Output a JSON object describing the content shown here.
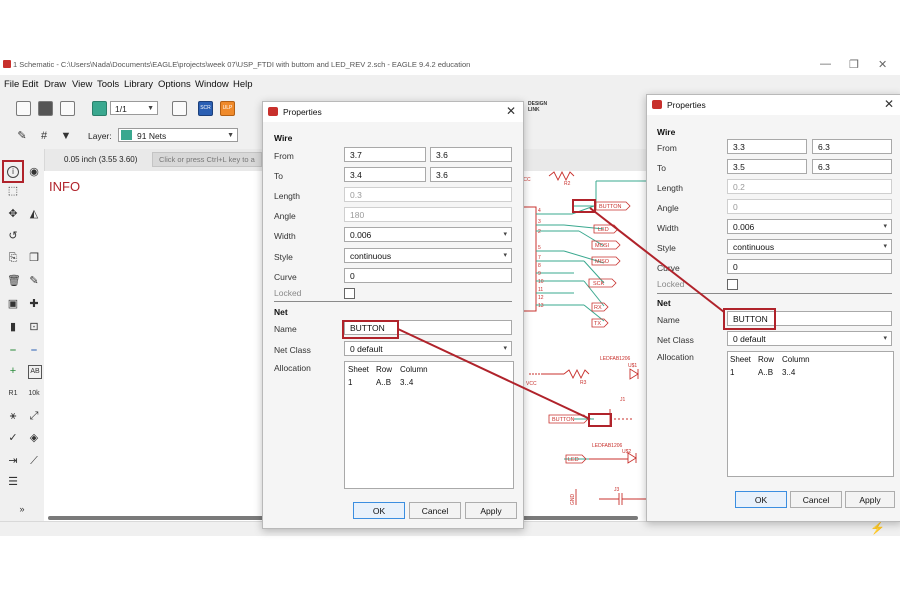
{
  "window": {
    "title": "1 Schematic - C:\\Users\\Nada\\Documents\\EAGLE\\projects\\week 07\\USP_FTDI with buttom and LED_REV 2.sch - EAGLE 9.4.2 education",
    "minimize": "—",
    "maximize": "❐",
    "close": "✕"
  },
  "menu": [
    "File",
    "Edit",
    "Draw",
    "View",
    "Tools",
    "Library",
    "Options",
    "Window",
    "Help"
  ],
  "toolbar": {
    "sheet_select": "1/1",
    "scr_label": "SCR",
    "ulp_label": "ULP",
    "design_link": "DESIGN LINK"
  },
  "layer_bar": {
    "layer_label": "Layer:",
    "layer_value": "91 Nets",
    "layer_color": "#3aa88f"
  },
  "status": {
    "coordinates": "0.05 inch (3.55 3.60)",
    "command_placeholder": "Click or press Ctrl+L key to a"
  },
  "canvas": {
    "info_label": "INFO",
    "net_labels": [
      "BUTTON",
      "LED",
      "MOSI",
      "MISO",
      "SCK",
      "RX",
      "TX",
      "BUTTON",
      "LED"
    ],
    "pin_numbers": [
      "4",
      "3",
      "2",
      "5",
      "7",
      "8",
      "9",
      "10",
      "11",
      "12",
      "13"
    ],
    "part_labels": [
      "R2",
      "R3",
      "J1",
      "U$1",
      "J3",
      "LEDFAB1206",
      "LEDFAB1206",
      "U$2",
      "VCC",
      "VCC",
      "GND"
    ]
  },
  "dialog_left": {
    "title": "Properties",
    "section_wire": "Wire",
    "from_label": "From",
    "from_x": "3.7",
    "from_y": "3.6",
    "to_label": "To",
    "to_x": "3.4",
    "to_y": "3.6",
    "length_label": "Length",
    "length": "0.3",
    "angle_label": "Angle",
    "angle": "180",
    "width_label": "Width",
    "width": "0.006",
    "style_label": "Style",
    "style": "continuous",
    "curve_label": "Curve",
    "curve": "0",
    "locked_label": "Locked",
    "section_net": "Net",
    "name_label": "Name",
    "name": "BUTTON",
    "netclass_label": "Net Class",
    "netclass": "0 default",
    "allocation_label": "Allocation",
    "alloc_headers": [
      "Sheet",
      "Row",
      "Column"
    ],
    "alloc_row": [
      "1",
      "A..B",
      "3..4"
    ],
    "ok": "OK",
    "cancel": "Cancel",
    "apply": "Apply"
  },
  "dialog_right": {
    "title": "Properties",
    "section_wire": "Wire",
    "from_label": "From",
    "from_x": "3.3",
    "from_y": "6.3",
    "to_label": "To",
    "to_x": "3.5",
    "to_y": "6.3",
    "length_label": "Length",
    "length": "0.2",
    "angle_label": "Angle",
    "angle": "0",
    "width_label": "Width",
    "width": "0.006",
    "style_label": "Style",
    "style": "continuous",
    "curve_label": "Curve",
    "curve": "0",
    "locked_label": "Locked",
    "section_net": "Net",
    "name_label": "Name",
    "name": "BUTTON",
    "netclass_label": "Net Class",
    "netclass": "0 default",
    "allocation_label": "Allocation",
    "alloc_headers": [
      "Sheet",
      "Row",
      "Column"
    ],
    "alloc_row": [
      "1",
      "A..B",
      "3..4"
    ],
    "ok": "OK",
    "cancel": "Cancel",
    "apply": "Apply"
  },
  "colors": {
    "highlight": "#b0232b",
    "net_wire": "#3aa88f",
    "schematic_red": "#c8302c",
    "accent_blue": "#3b8ee0"
  }
}
